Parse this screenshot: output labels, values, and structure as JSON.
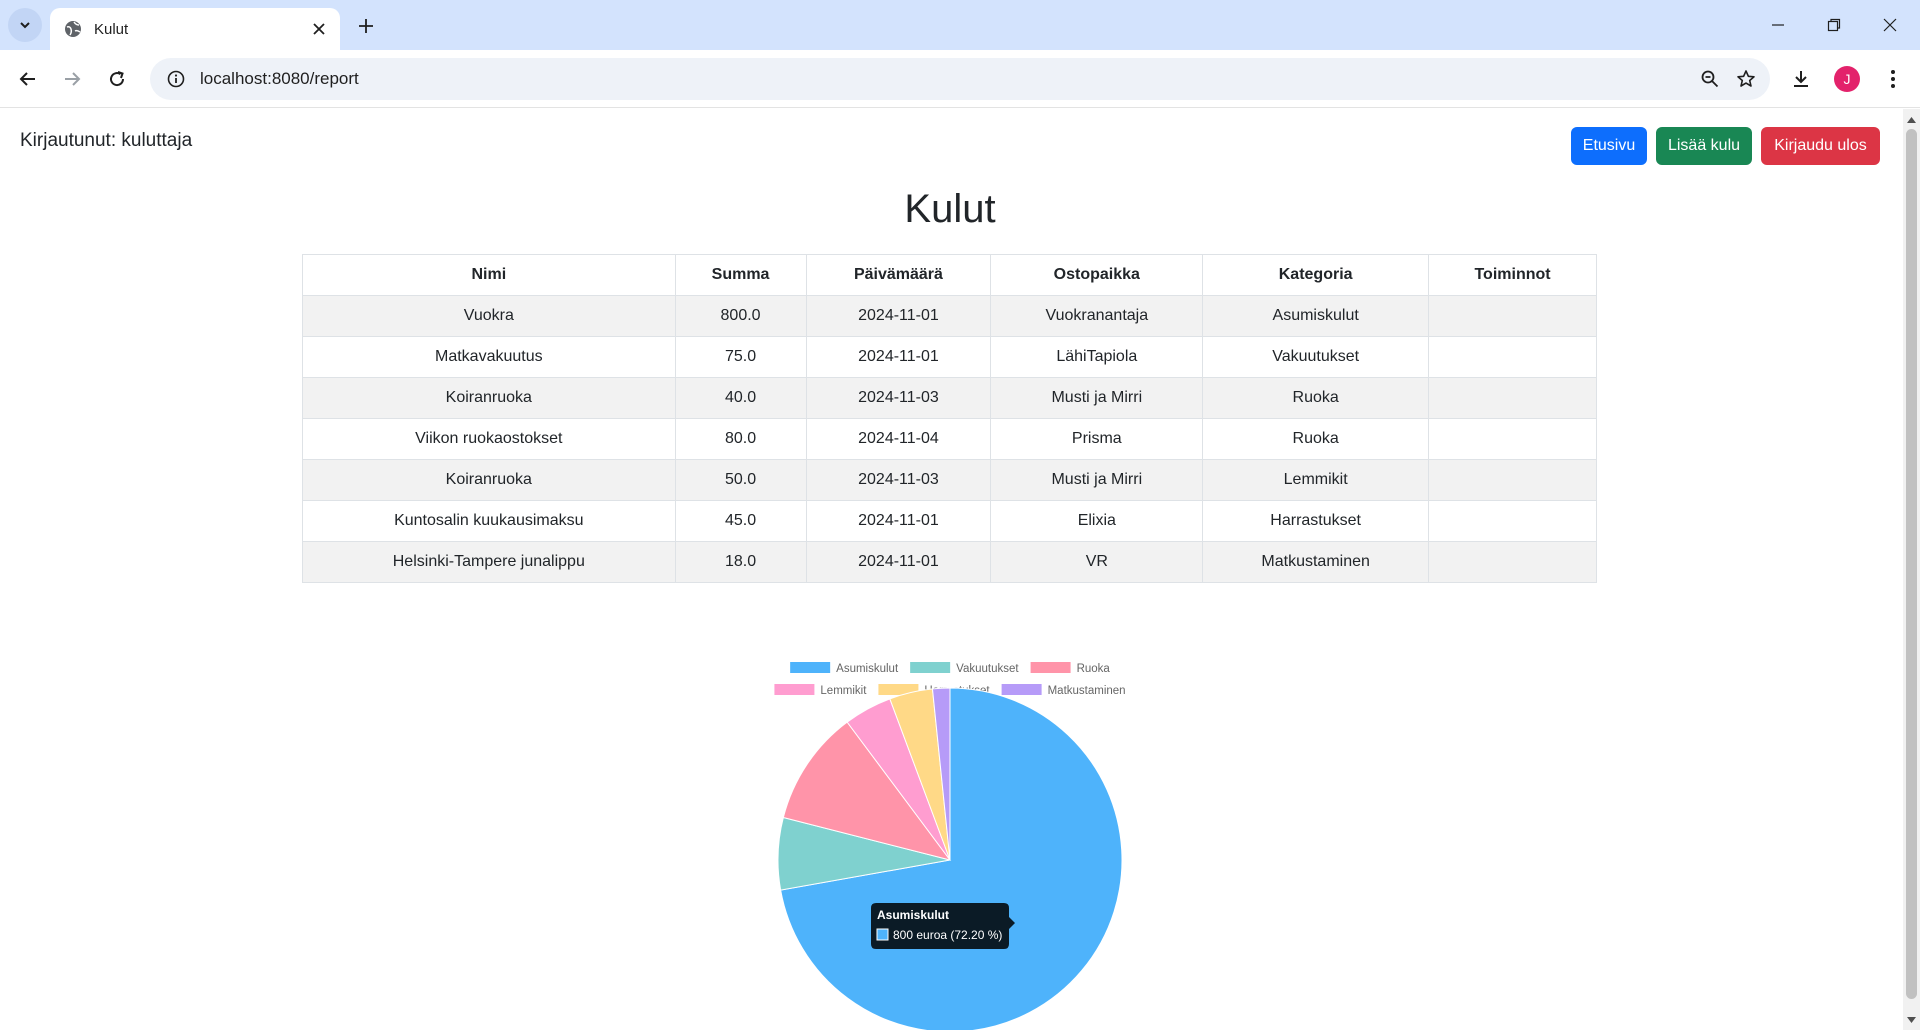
{
  "browser": {
    "tab_title": "Kulut",
    "url": "localhost:8080/report",
    "avatar_letter": "J"
  },
  "header": {
    "login_status": "Kirjautunut: kuluttaja",
    "buttons": {
      "home": "Etusivu",
      "add_expense": "Lisää kulu",
      "logout": "Kirjaudu ulos"
    }
  },
  "page_title": "Kulut",
  "table": {
    "columns": [
      "Nimi",
      "Summa",
      "Päivämäärä",
      "Ostopaikka",
      "Kategoria",
      "Toiminnot"
    ],
    "rows": [
      [
        "Vuokra",
        "800.0",
        "2024-11-01",
        "Vuokranantaja",
        "Asumiskulut",
        ""
      ],
      [
        "Matkavakuutus",
        "75.0",
        "2024-11-01",
        "LähiTapiola",
        "Vakuutukset",
        ""
      ],
      [
        "Koiranruoka",
        "40.0",
        "2024-11-03",
        "Musti ja Mirri",
        "Ruoka",
        ""
      ],
      [
        "Viikon ruokaostokset",
        "80.0",
        "2024-11-04",
        "Prisma",
        "Ruoka",
        ""
      ],
      [
        "Koiranruoka",
        "50.0",
        "2024-11-03",
        "Musti ja Mirri",
        "Lemmikit",
        ""
      ],
      [
        "Kuntosalin kuukausimaksu",
        "45.0",
        "2024-11-01",
        "Elixia",
        "Harrastukset",
        ""
      ],
      [
        "Helsinki-Tampere junalippu",
        "18.0",
        "2024-11-01",
        "VR",
        "Matkustaminen",
        ""
      ]
    ]
  },
  "chart_data": {
    "type": "pie",
    "categories": [
      "Asumiskulut",
      "Vakuutukset",
      "Ruoka",
      "Lemmikit",
      "Harrastukset",
      "Matkustaminen"
    ],
    "values": [
      800,
      75,
      120,
      50,
      45,
      18
    ],
    "colors": [
      "#4eb3fb",
      "#7fd1cf",
      "#ff94a9",
      "#ff9dd0",
      "#ffd987",
      "#b69bf8"
    ],
    "legend": "top",
    "tooltip": {
      "title": "Asumiskulut",
      "label": "800 euroa (72.20 %)"
    }
  }
}
